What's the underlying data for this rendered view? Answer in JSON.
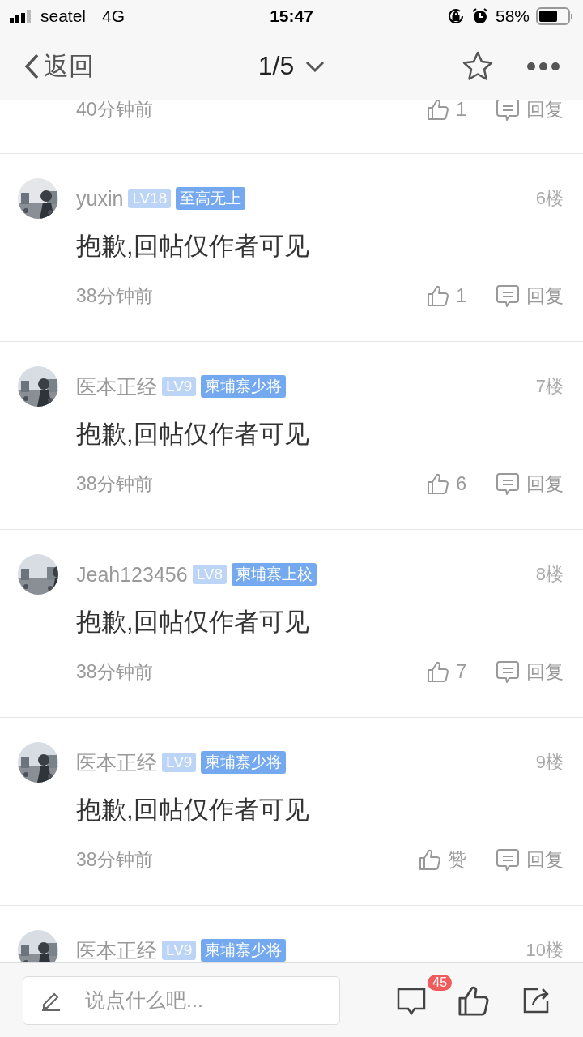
{
  "status_bar": {
    "carrier": "seatel",
    "network": "4G",
    "time": "15:47",
    "battery": "58%"
  },
  "nav": {
    "back": "返回",
    "page": "1/5"
  },
  "posts": [
    {
      "kind": "footer",
      "time": "40分钟前",
      "likes": "1",
      "reply": "回复"
    },
    {
      "kind": "full",
      "user": "yuxin",
      "rank": "LV18",
      "title": "至高无上",
      "floor": "6楼",
      "text": "抱歉,回帖仅作者可见",
      "time": "38分钟前",
      "likes": "1",
      "reply": "回复"
    },
    {
      "kind": "full",
      "user": "医本正经",
      "rank": "LV9",
      "title": "柬埔寨少将",
      "floor": "7楼",
      "text": "抱歉,回帖仅作者可见",
      "time": "38分钟前",
      "likes": "6",
      "reply": "回复"
    },
    {
      "kind": "full",
      "user": "Jeah123456",
      "rank": "LV8",
      "title": "柬埔寨上校",
      "floor": "8楼",
      "text": "抱歉,回帖仅作者可见",
      "time": "38分钟前",
      "likes": "7",
      "reply": "回复"
    },
    {
      "kind": "full",
      "user": "医本正经",
      "rank": "LV9",
      "title": "柬埔寨少将",
      "floor": "9楼",
      "text": "抱歉,回帖仅作者可见",
      "time": "38分钟前",
      "likes": "赞",
      "reply": "回复"
    },
    {
      "kind": "header",
      "user": "医本正经",
      "rank": "LV9",
      "title": "柬埔寨少将",
      "floor": "10楼"
    }
  ],
  "bottom_bar": {
    "placeholder": "说点什么吧...",
    "comment_badge": "45"
  }
}
